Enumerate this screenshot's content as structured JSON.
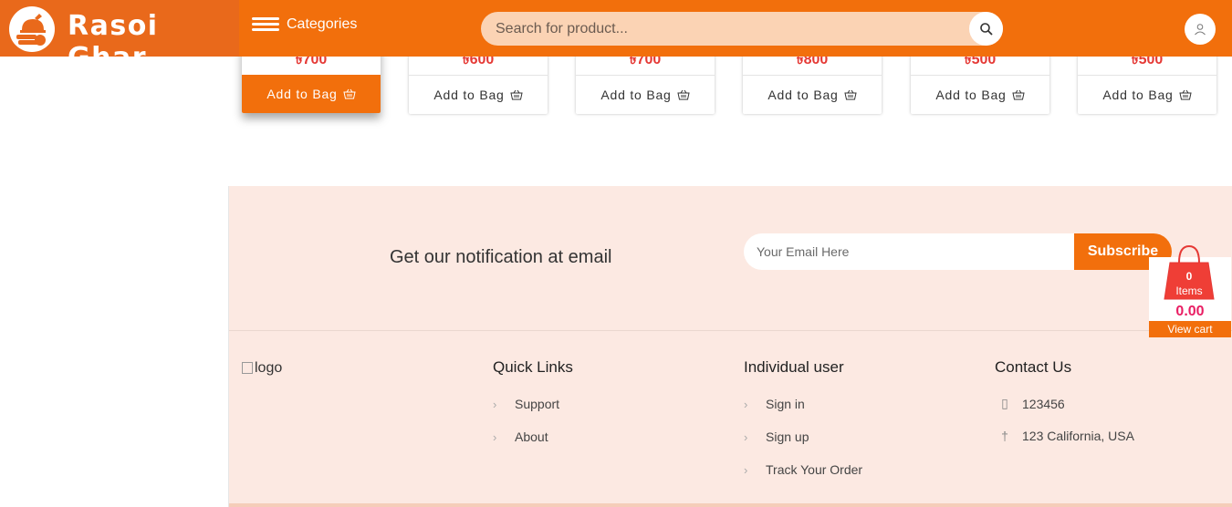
{
  "brand": {
    "name": "Rasoi Ghar"
  },
  "header": {
    "categories_label": "Categories",
    "search_placeholder": "Search for product..."
  },
  "products": [
    {
      "price": "৳700",
      "add_label": "Add to Bag",
      "active": true
    },
    {
      "price": "৳600",
      "add_label": "Add to Bag",
      "active": false
    },
    {
      "price": "৳700",
      "add_label": "Add to Bag",
      "active": false
    },
    {
      "price": "৳800",
      "add_label": "Add to Bag",
      "active": false
    },
    {
      "price": "৳500",
      "add_label": "Add to Bag",
      "active": false
    },
    {
      "price": "৳500",
      "add_label": "Add to Bag",
      "active": false
    }
  ],
  "newsletter": {
    "title": "Get our notification at email",
    "email_placeholder": "Your Email Here",
    "subscribe_label": "Subscribe"
  },
  "footer": {
    "logo_alt": "logo",
    "quick_links": {
      "title": "Quick Links",
      "items": [
        "Support",
        "About"
      ]
    },
    "individual_user": {
      "title": "Individual user",
      "items": [
        "Sign in",
        "Sign up",
        "Track Your Order"
      ]
    },
    "contact": {
      "title": "Contact Us",
      "phone": "123456",
      "address": "123 California, USA"
    }
  },
  "cart": {
    "count": "0",
    "items_label": "Items",
    "total": "0.00",
    "view_label": "View cart"
  },
  "colors": {
    "primary": "#f26f0c",
    "price": "#e53935",
    "footer_bg": "#fce9e2",
    "search_bg": "#fbd3b4"
  }
}
